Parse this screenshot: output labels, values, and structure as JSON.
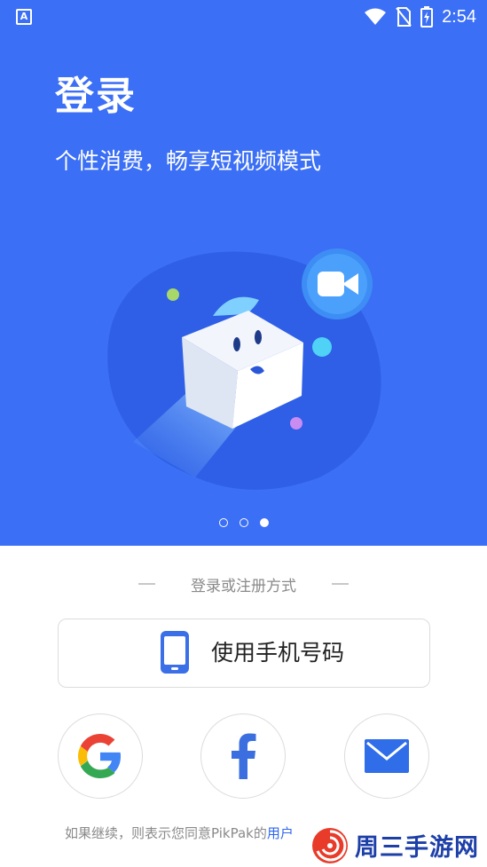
{
  "status_bar": {
    "left_indicator": "A",
    "time": "2:54",
    "icons": [
      "wifi-icon",
      "no-sim-icon",
      "battery-charging-icon"
    ]
  },
  "hero": {
    "title": "登录",
    "subtitle": "个性消费，畅享短视频模式",
    "carousel": {
      "total": 3,
      "active_index": 2
    }
  },
  "login": {
    "divider_text": "登录或注册方式",
    "phone_button_label": "使用手机号码",
    "social": [
      "google-icon",
      "facebook-icon",
      "mail-icon"
    ],
    "terms_prefix": "如果继续，则表示您同意PikPak的",
    "terms_link": "用户"
  },
  "watermark": {
    "text": "周三手游网"
  },
  "colors": {
    "hero_background": "#3b6ff5",
    "link": "#2f66f0",
    "google_blue": "#4285F4",
    "google_red": "#EA4335",
    "google_yellow": "#FBBC05",
    "google_green": "#34A853",
    "facebook_blue": "#3b6fe0",
    "mail_blue": "#2f6ee8"
  }
}
